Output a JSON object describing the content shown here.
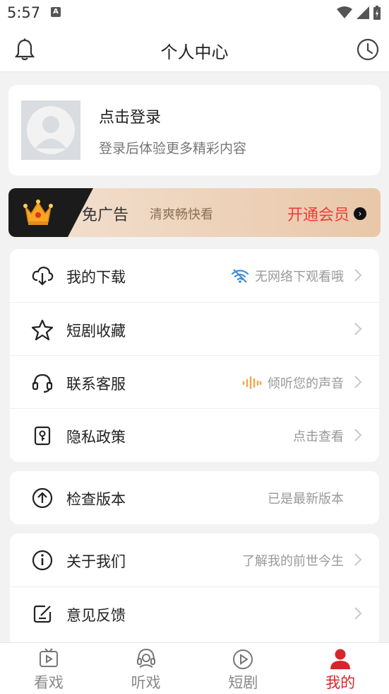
{
  "status": {
    "time": "5:57",
    "notif": "A"
  },
  "header": {
    "title": "个人中心"
  },
  "login": {
    "title": "点击登录",
    "subtitle": "登录后体验更多精彩内容"
  },
  "vip": {
    "main": "免广告",
    "sub": "清爽畅快看",
    "button": "开通会员"
  },
  "menu1": [
    {
      "label": "我的下载",
      "right": "无网络下观看哦",
      "icon": "cloud-download-icon",
      "right_icon": "wifi-icon"
    },
    {
      "label": "短剧收藏",
      "right": "",
      "icon": "star-icon"
    },
    {
      "label": "联系客服",
      "right": "倾听您的声音",
      "icon": "headset-icon",
      "right_icon": "sound-wave-icon"
    },
    {
      "label": "隐私政策",
      "right": "点击查看",
      "icon": "privacy-icon"
    }
  ],
  "menu2": [
    {
      "label": "检查版本",
      "right": "已是最新版本",
      "icon": "upgrade-icon"
    }
  ],
  "menu3": [
    {
      "label": "关于我们",
      "right": "了解我的前世今生",
      "icon": "info-icon"
    },
    {
      "label": "意见反馈",
      "right": "",
      "icon": "feedback-icon"
    }
  ],
  "tabs": [
    {
      "label": "看戏",
      "icon": "tv-play-icon"
    },
    {
      "label": "听戏",
      "icon": "headphone-icon"
    },
    {
      "label": "短剧",
      "icon": "play-circle-icon"
    },
    {
      "label": "我的",
      "icon": "user-icon",
      "active": true
    }
  ],
  "colors": {
    "accent": "#d6262c",
    "vip_text": "#f23b3b"
  }
}
